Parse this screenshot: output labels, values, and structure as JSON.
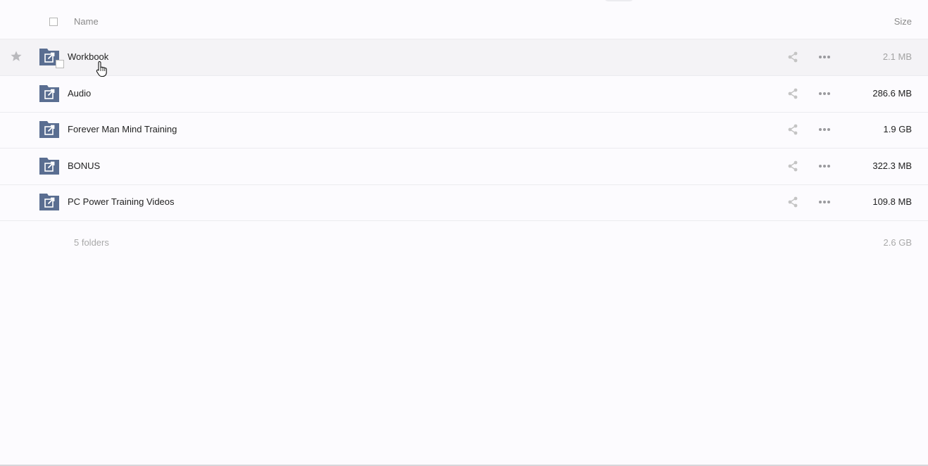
{
  "header": {
    "name_label": "Name",
    "size_label": "Size"
  },
  "rows": [
    {
      "name": "Workbook",
      "size": "2.1 MB",
      "icon": "shared-folder-icon",
      "state": "hover"
    },
    {
      "name": "Audio",
      "size": "286.6 MB",
      "icon": "shared-folder-icon"
    },
    {
      "name": "Forever Man Mind Training",
      "size": "1.9 GB",
      "icon": "shared-folder-icon"
    },
    {
      "name": "BONUS",
      "size": "322.3 MB",
      "icon": "shared-folder-icon"
    },
    {
      "name": "PC Power Training Videos",
      "size": "109.8 MB",
      "icon": "shared-folder-icon"
    }
  ],
  "summary": {
    "count": "5 folders",
    "total_size": "2.6 GB"
  },
  "colors": {
    "folder": "#5a6e91",
    "background": "#fcfbfe",
    "hover_row": "#f4f3f6",
    "muted_text": "#a9a9a9",
    "action_icon": "#c4c4c4"
  },
  "icons": {
    "favorite": "star-icon",
    "folder": "shared-folder-icon",
    "share": "share-icon",
    "more": "more-options-icon",
    "cursor": "hand-pointer-icon"
  }
}
